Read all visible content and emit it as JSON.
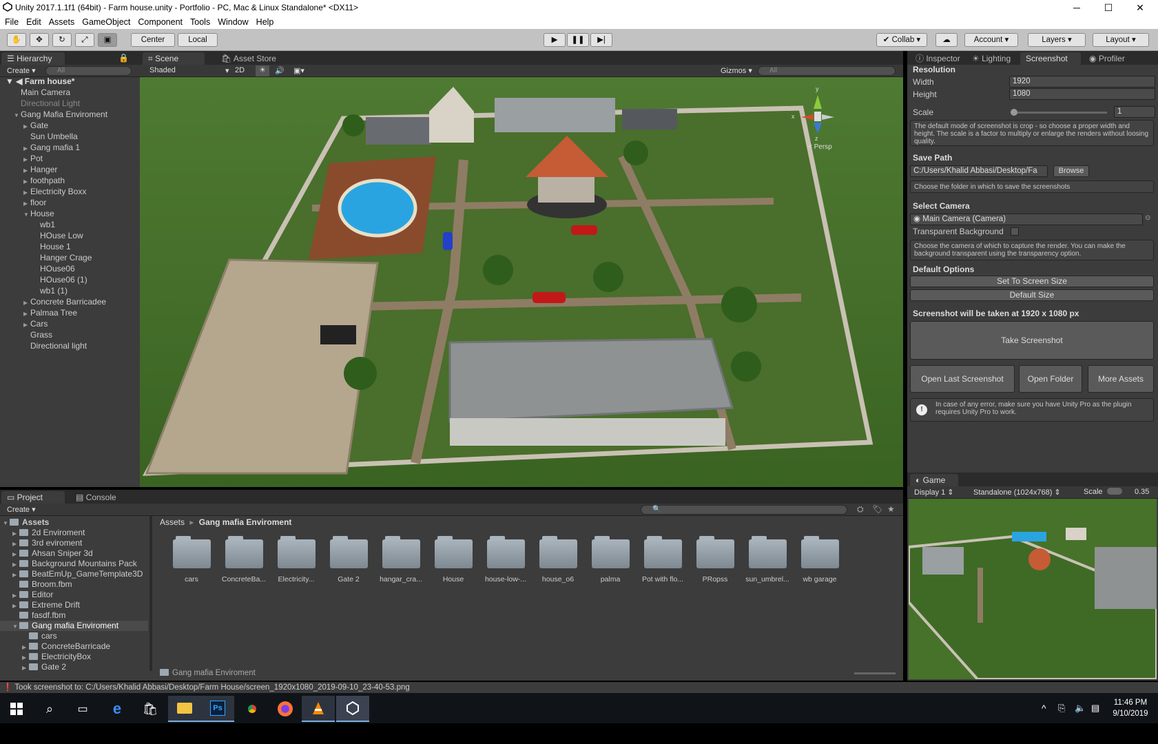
{
  "window": {
    "title": "Unity 2017.1.1f1 (64bit) - Farm house.unity - Portfolio - PC, Mac & Linux Standalone* <DX11>"
  },
  "menu": [
    "File",
    "Edit",
    "Assets",
    "GameObject",
    "Component",
    "Tools",
    "Window",
    "Help"
  ],
  "toolbar": {
    "center": "Center",
    "local": "Local",
    "collab": "Collab",
    "account": "Account",
    "layers": "Layers",
    "layout": "Layout"
  },
  "hierarchy": {
    "tab": "Hierarchy",
    "create": "Create",
    "search": "All",
    "scene": "Farm house*",
    "items": [
      {
        "label": "Main Camera",
        "indent": 1,
        "arrow": ""
      },
      {
        "label": "Directional Light",
        "indent": 1,
        "arrow": "",
        "dim": true
      },
      {
        "label": "Gang Mafia Enviroment",
        "indent": 1,
        "arrow": "▼"
      },
      {
        "label": "Gate",
        "indent": 2,
        "arrow": "▶"
      },
      {
        "label": "Sun Umbella",
        "indent": 2,
        "arrow": ""
      },
      {
        "label": "Gang mafia 1",
        "indent": 2,
        "arrow": "▶"
      },
      {
        "label": "Pot",
        "indent": 2,
        "arrow": "▶"
      },
      {
        "label": "Hanger",
        "indent": 2,
        "arrow": "▶"
      },
      {
        "label": "foothpath",
        "indent": 2,
        "arrow": "▶"
      },
      {
        "label": "Electricity Boxx",
        "indent": 2,
        "arrow": "▶"
      },
      {
        "label": "floor",
        "indent": 2,
        "arrow": "▶"
      },
      {
        "label": "House",
        "indent": 2,
        "arrow": "▼"
      },
      {
        "label": "wb1",
        "indent": 3,
        "arrow": ""
      },
      {
        "label": "HOuse Low",
        "indent": 3,
        "arrow": ""
      },
      {
        "label": "House 1",
        "indent": 3,
        "arrow": ""
      },
      {
        "label": "Hanger Crage",
        "indent": 3,
        "arrow": ""
      },
      {
        "label": "HOuse06",
        "indent": 3,
        "arrow": ""
      },
      {
        "label": "HOuse06 (1)",
        "indent": 3,
        "arrow": ""
      },
      {
        "label": "wb1 (1)",
        "indent": 3,
        "arrow": ""
      },
      {
        "label": "Concrete Barricadee",
        "indent": 2,
        "arrow": "▶"
      },
      {
        "label": "Palmaa Tree",
        "indent": 2,
        "arrow": "▶"
      },
      {
        "label": "Cars",
        "indent": 2,
        "arrow": "▶"
      },
      {
        "label": "Grass",
        "indent": 2,
        "arrow": ""
      },
      {
        "label": "Directional light",
        "indent": 2,
        "arrow": ""
      }
    ]
  },
  "scene": {
    "tab": "Scene",
    "asset_store": "Asset Store",
    "shading": "Shaded",
    "mode_2d": "2D",
    "gizmos": "Gizmos",
    "search": "All",
    "gizmo": {
      "x": "x",
      "y": "y",
      "z": "z",
      "persp": "< Persp"
    }
  },
  "inspector": {
    "tabs": [
      "Inspector",
      "Lighting",
      "Screenshot",
      "Profiler"
    ],
    "resolution": "Resolution",
    "width_label": "Width",
    "width": "1920",
    "height_label": "Height",
    "height": "1080",
    "scale_label": "Scale",
    "scale": "1",
    "help_crop": "The default mode of screenshot is crop - so choose a proper width and height. The scale is a factor to multiply or enlarge the renders without loosing quality.",
    "save_path": "Save Path",
    "path": "C:/Users/Khalid Abbasi/Desktop/Fa",
    "browse": "Browse",
    "help_folder": "Choose the folder in which to save the screenshots",
    "select_camera": "Select Camera",
    "camera": "Main Camera (Camera)",
    "transparent": "Transparent Background",
    "help_camera": "Choose the camera of which to capture the render. You can make the background transparent using the transparency option.",
    "default_options": "Default Options",
    "set_screen": "Set To Screen Size",
    "default_size": "Default Size",
    "will_be_taken": "Screenshot will be taken at 1920 x 1080 px",
    "take": "Take Screenshot",
    "open_last": "Open Last Screenshot",
    "open_folder": "Open Folder",
    "more_assets": "More Assets",
    "warning": "In case of any error, make sure you have Unity Pro as the plugin requires Unity Pro to work."
  },
  "game": {
    "tab": "Game",
    "display": "Display 1",
    "res": "Standalone (1024x768)",
    "scale_label": "Scale",
    "scale": "0.35"
  },
  "project": {
    "tabs": [
      "Project",
      "Console"
    ],
    "create": "Create",
    "tree": [
      {
        "label": "Assets",
        "indent": 0,
        "arrow": "▼",
        "bold": true
      },
      {
        "label": "2d Enviroment",
        "indent": 1,
        "arrow": "▶"
      },
      {
        "label": "3rd eviroment",
        "indent": 1,
        "arrow": "▶"
      },
      {
        "label": "Ahsan Sniper 3d",
        "indent": 1,
        "arrow": "▶"
      },
      {
        "label": "Background Mountains Pack",
        "indent": 1,
        "arrow": "▶"
      },
      {
        "label": "BeatEmUp_GameTemplate3D",
        "indent": 1,
        "arrow": "▶"
      },
      {
        "label": "Broom.fbm",
        "indent": 1,
        "arrow": ""
      },
      {
        "label": "Editor",
        "indent": 1,
        "arrow": "▶"
      },
      {
        "label": "Extreme Drift",
        "indent": 1,
        "arrow": "▶"
      },
      {
        "label": "fasdf.fbm",
        "indent": 1,
        "arrow": ""
      },
      {
        "label": "Gang mafia Enviroment",
        "indent": 1,
        "arrow": "▼",
        "selected": true
      },
      {
        "label": "cars",
        "indent": 2,
        "arrow": ""
      },
      {
        "label": "ConcreteBarricade",
        "indent": 2,
        "arrow": "▶"
      },
      {
        "label": "ElectricityBox",
        "indent": 2,
        "arrow": "▶"
      },
      {
        "label": "Gate 2",
        "indent": 2,
        "arrow": "▶"
      }
    ],
    "breadcrumb": [
      "Assets",
      "Gang mafia Enviroment"
    ],
    "folders": [
      "cars",
      "ConcreteBa...",
      "Electricity...",
      "Gate 2",
      "hangar_cra...",
      "House",
      "house-low-...",
      "house_o6",
      "palma",
      "Pot with flo...",
      "PRopss",
      "sun_umbrel...",
      "wb garage"
    ],
    "footer": "Gang mafia Enviroment"
  },
  "status": {
    "message": "Took screenshot to: C:/Users/Khalid Abbasi/Desktop/Farm House/screen_1920x1080_2019-09-10_23-40-53.png"
  },
  "taskbar": {
    "time": "11:46 PM",
    "date": "9/10/2019"
  }
}
